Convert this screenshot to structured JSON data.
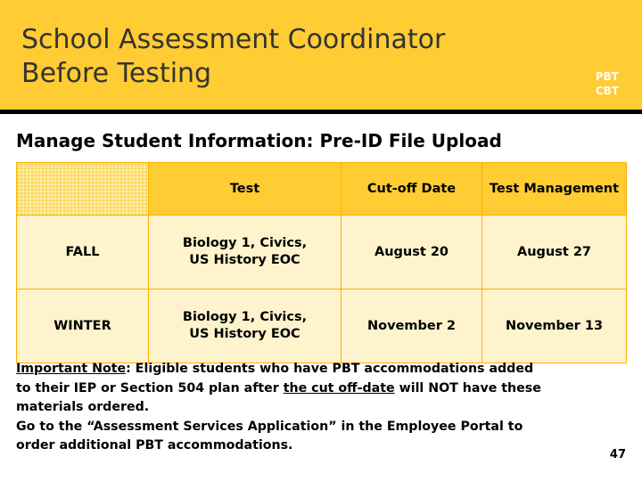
{
  "header": {
    "title": "School Assessment Coordinator\nBefore Testing",
    "mode_line1": "PBT",
    "mode_line2": "CBT",
    "band_color": "#ffcc33"
  },
  "section": {
    "title": "Manage Student Information: Pre-ID File Upload"
  },
  "table": {
    "columns": [
      "",
      "Test",
      "Cut-off Date",
      "Test Management"
    ],
    "rows": [
      {
        "label": "FALL",
        "test": "Biology 1, Civics,\nUS History EOC",
        "cutoff": "August 20",
        "management": "August 27"
      },
      {
        "label": "WINTER",
        "test": "Biology 1, Civics,\nUS History EOC",
        "cutoff": "November 2",
        "management": "November 13"
      }
    ]
  },
  "notes": {
    "line1_label": "Important Note",
    "line1_rest": ": Eligible students who have PBT accommodations added",
    "line2_a": "to their IEP or Section 504 plan after ",
    "line2_underline": "the cut off-date",
    "line2_b": " will NOT have these",
    "line3": "materials ordered.",
    "line4": "Go to the “Assessment Services Application” in the Employee Portal to",
    "line5": "order additional PBT accommodations."
  },
  "page_number": "47"
}
